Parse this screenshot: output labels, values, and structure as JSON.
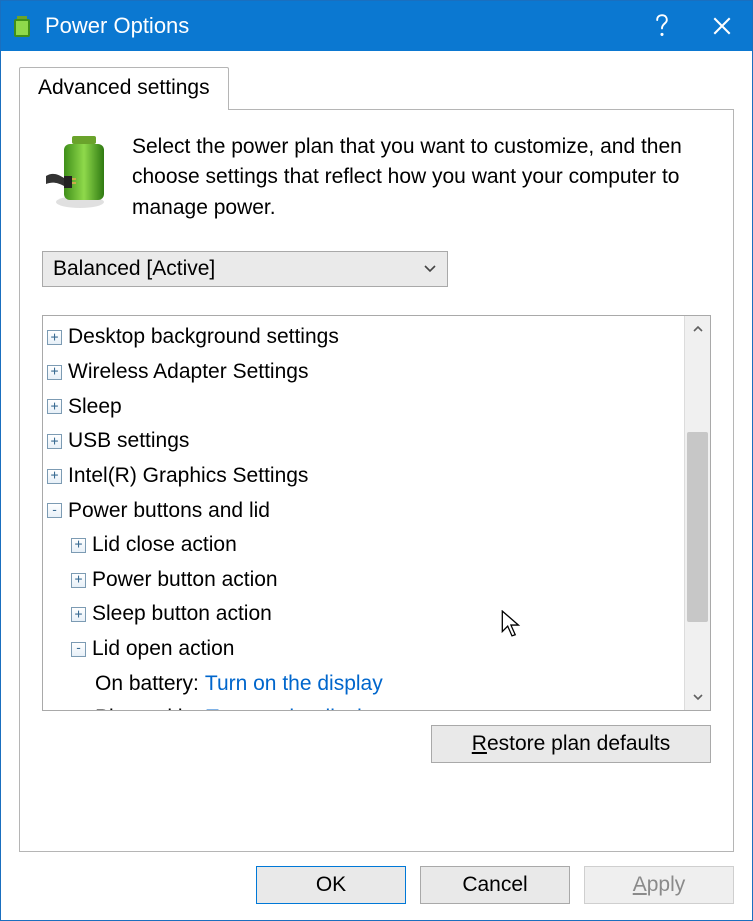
{
  "title": "Power Options",
  "tab": {
    "label": "Advanced settings"
  },
  "intro": "Select the power plan that you want to customize, and then choose settings that reflect how you want your computer to manage power.",
  "plan": {
    "selected": "Balanced [Active]"
  },
  "tree": {
    "items": [
      {
        "label": "Desktop background settings"
      },
      {
        "label": "Wireless Adapter Settings"
      },
      {
        "label": "Sleep"
      },
      {
        "label": "USB settings"
      },
      {
        "label": "Intel(R) Graphics Settings"
      }
    ],
    "power_buttons": {
      "label": "Power buttons and lid",
      "children": [
        {
          "label": "Lid close action"
        },
        {
          "label": "Power button action"
        },
        {
          "label": "Sleep button action"
        }
      ],
      "lid_open": {
        "label": "Lid open action",
        "on_battery_label": "On battery:",
        "on_battery_value": "Turn on the display",
        "plugged_in_label": "Plugged in:",
        "plugged_in_value": "Turn on the display"
      }
    }
  },
  "buttons": {
    "restore": "Restore plan defaults",
    "ok": "OK",
    "cancel": "Cancel",
    "apply": "Apply"
  }
}
